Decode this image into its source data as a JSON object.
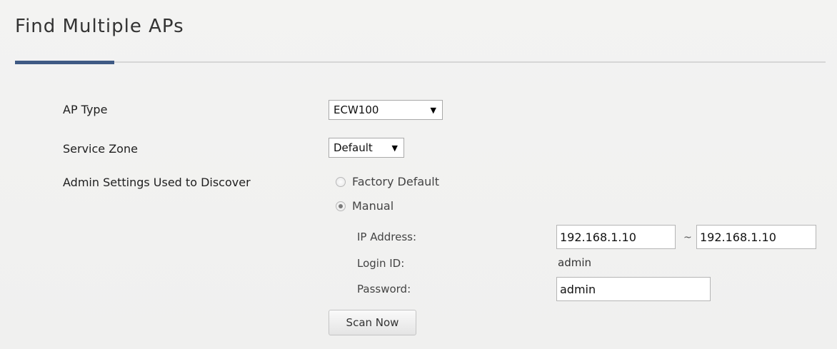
{
  "page": {
    "title": "Find Multiple APs"
  },
  "form": {
    "ap_type": {
      "label": "AP Type",
      "selected": "ECW100"
    },
    "service_zone": {
      "label": "Service Zone",
      "selected": "Default"
    },
    "admin_settings": {
      "label": "Admin Settings Used to Discover",
      "options": [
        {
          "label": "Factory Default",
          "checked": false
        },
        {
          "label": "Manual",
          "checked": true
        }
      ]
    },
    "ip_address": {
      "label": "IP Address:",
      "start": "192.168.1.10",
      "separator": "~",
      "end": "192.168.1.10"
    },
    "login_id": {
      "label": "Login ID:",
      "value": "admin"
    },
    "password": {
      "label": "Password:",
      "value": "admin"
    },
    "scan_button": "Scan Now"
  },
  "colors": {
    "accent": "#3f5a84",
    "background": "#f1f1f0"
  },
  "icons": {
    "dropdown": "caret-down-icon"
  }
}
